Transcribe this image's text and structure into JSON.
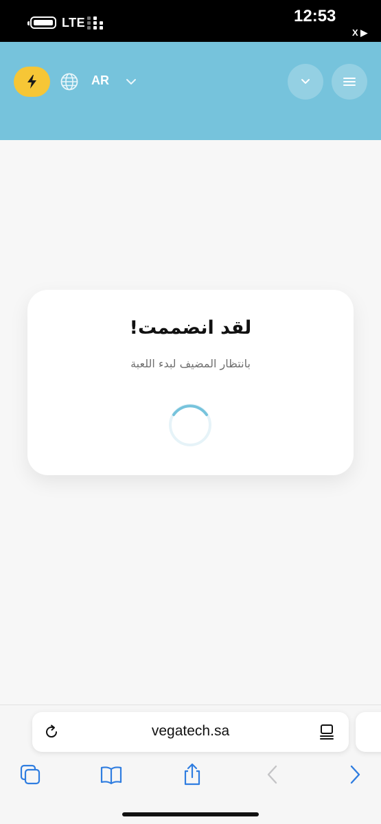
{
  "status_bar": {
    "network": "LTE",
    "time": "12:53",
    "indicator": "X ▶"
  },
  "header": {
    "language": "AR",
    "accent_color": "#76c3dc",
    "bolt_color": "#f6c636",
    "icons": [
      "bolt-icon",
      "globe-icon",
      "chevron-down-icon",
      "chevron-down-icon",
      "menu-icon"
    ]
  },
  "card": {
    "title": "لقد انضممت!",
    "subtitle": "بانتظار المضيف لبدء اللعبة"
  },
  "browser": {
    "url": "vegatech.sa",
    "toolbar_icons": [
      "tabs-icon",
      "bookmarks-icon",
      "share-icon",
      "back-icon",
      "forward-icon"
    ]
  }
}
